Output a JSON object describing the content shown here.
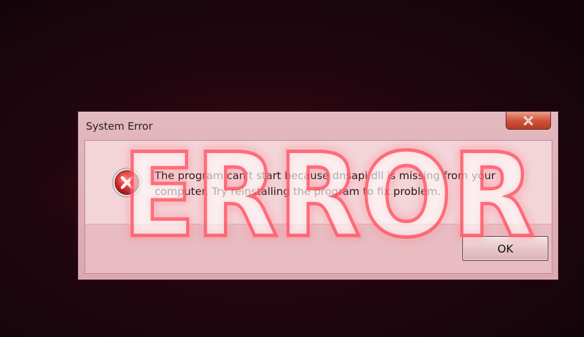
{
  "dialog": {
    "title": "System Error",
    "message": "The program can't start because dnsapi.dll is missing from your computer. Try reinstalling the program to fix problem.",
    "ok_label": "OK",
    "icon": "error-icon"
  },
  "overlay": {
    "text": "ERROR"
  },
  "colors": {
    "background": "#22060f",
    "dialog_body": "#f3d4d8",
    "close_button": "#c94a32",
    "error_icon": "#d42a2a",
    "overlay_glow": "#ff5060"
  }
}
